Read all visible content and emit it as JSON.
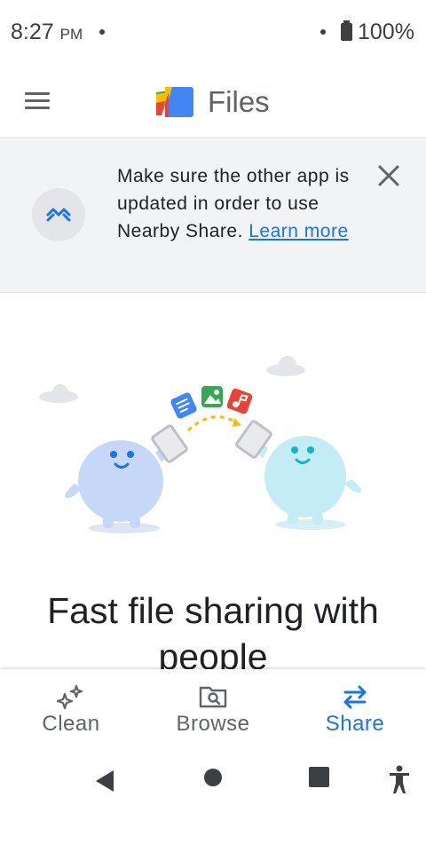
{
  "status_bar": {
    "time": "8:27",
    "ampm": "PM",
    "battery": "100%"
  },
  "app_bar": {
    "title": "Files"
  },
  "banner": {
    "message": "Make sure the other app is updated in order to use Nearby Share.",
    "link_text": "Learn more"
  },
  "main": {
    "headline": "Fast file sharing with people"
  },
  "bottom_nav": {
    "items": [
      {
        "label": "Clean",
        "icon": "sparkle-icon",
        "active": false
      },
      {
        "label": "Browse",
        "icon": "folder-search-icon",
        "active": false
      },
      {
        "label": "Share",
        "icon": "swap-arrows-icon",
        "active": true
      }
    ]
  },
  "colors": {
    "accent": "#1a73e8",
    "banner_bg": "#f1f3f4",
    "text": "#202124",
    "secondary": "#5f6368"
  }
}
